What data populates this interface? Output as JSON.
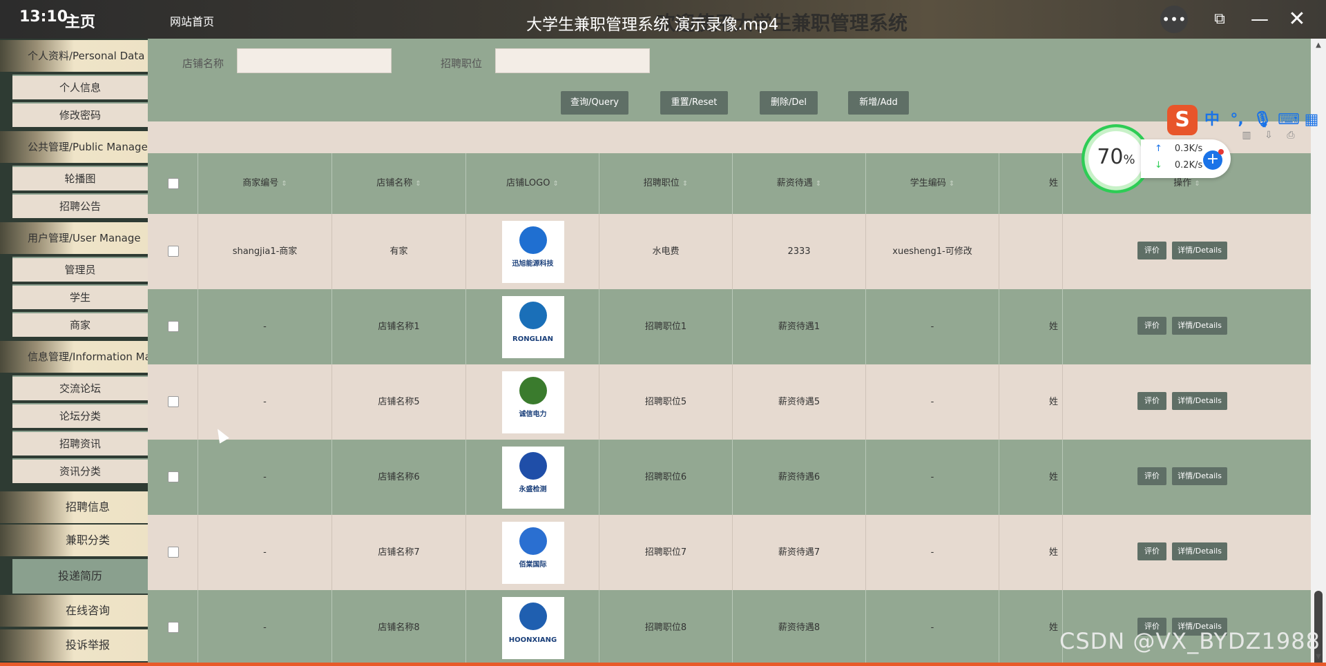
{
  "player": {
    "clock": "13:10",
    "video_title": "大学生兼职管理系统 演示录像.mp4",
    "more_icon": "more-icon",
    "close_icon": "close-icon"
  },
  "header": {
    "home_label": "主页",
    "site_home": "网站首页",
    "system_title": "欢迎使用大学生兼职管理系统"
  },
  "sidebar": {
    "categories": [
      {
        "label": "个人资料/Personal Data"
      },
      {
        "label": "公共管理/Public Manage"
      },
      {
        "label": "用户管理/User Manage"
      },
      {
        "label": "信息管理/Information Ma"
      }
    ],
    "items": [
      {
        "label": "个人信息"
      },
      {
        "label": "修改密码"
      },
      {
        "label": "轮播图"
      },
      {
        "label": "招聘公告"
      },
      {
        "label": "管理员"
      },
      {
        "label": "学生"
      },
      {
        "label": "商家"
      },
      {
        "label": "交流论坛"
      },
      {
        "label": "论坛分类"
      },
      {
        "label": "招聘资讯"
      },
      {
        "label": "资讯分类"
      }
    ],
    "top_items": [
      {
        "label": "招聘信息"
      },
      {
        "label": "兼职分类"
      },
      {
        "label": "投递简历"
      },
      {
        "label": "在线咨询"
      },
      {
        "label": "投诉举报"
      }
    ]
  },
  "search": {
    "shop_label": "店铺名称",
    "shop_value": "",
    "position_label": "招聘职位",
    "position_value": "",
    "buttons": {
      "query": "查询/Query",
      "reset": "重置/Reset",
      "delete": "删除/Del",
      "add": "新增/Add"
    }
  },
  "table": {
    "headers": [
      "商家编号",
      "店铺名称",
      "店铺LOGO",
      "招聘职位",
      "薪资待遇",
      "学生编码",
      "姓",
      "操作"
    ],
    "rows": [
      {
        "merchant": "shangjia1-商家",
        "shop": "有家",
        "logo_text": "迅旭能源科技",
        "position": "水电费",
        "salary": "2333",
        "student": "xuesheng1-可修改",
        "name": ""
      },
      {
        "merchant": "-",
        "shop": "店铺名称1",
        "logo_text": "RONGLIAN",
        "position": "招聘职位1",
        "salary": "薪资待遇1",
        "student": "-",
        "name": "姓"
      },
      {
        "merchant": "-",
        "shop": "店铺名称5",
        "logo_text": "诚信电力",
        "position": "招聘职位5",
        "salary": "薪资待遇5",
        "student": "-",
        "name": "姓"
      },
      {
        "merchant": "-",
        "shop": "店铺名称6",
        "logo_text": "永盛检测",
        "position": "招聘职位6",
        "salary": "薪资待遇6",
        "student": "-",
        "name": "姓"
      },
      {
        "merchant": "-",
        "shop": "店铺名称7",
        "logo_text": "佰棠国际",
        "position": "招聘职位7",
        "salary": "薪资待遇7",
        "student": "-",
        "name": "姓"
      },
      {
        "merchant": "-",
        "shop": "店铺名称8",
        "logo_text": "HOONXIANG",
        "position": "招聘职位8",
        "salary": "薪资待遇8",
        "student": "-",
        "name": "姓"
      }
    ],
    "actions": {
      "review": "评价",
      "details": "详情/Details"
    }
  },
  "ime": {
    "logo": "S",
    "zh": "中",
    "punct": "°,",
    "mic_icon": "microphone-icon",
    "keyboard_icon": "keyboard-icon",
    "apps_icon": "apps-icon"
  },
  "network": {
    "percent": "70",
    "percent_unit": "%",
    "up": "0.3K/s",
    "down": "0.2K/s"
  },
  "watermark": "CSDN @VX_BYDZ1988",
  "colors": {
    "sage": "#93a892",
    "cream": "#e6dad0",
    "button": "#5f6f66"
  }
}
